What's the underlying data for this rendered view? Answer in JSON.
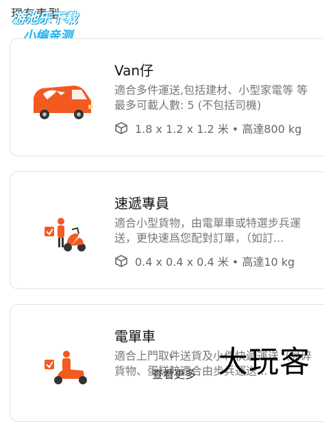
{
  "page": {
    "heading": "現有車型",
    "view_more": "查看更多"
  },
  "watermarks": {
    "top_left_line1": "游池乐下载",
    "top_left_line2": "小编亲测",
    "bottom_right": "大玩客"
  },
  "vehicles": [
    {
      "name": "Van仔",
      "description": "適合多件運送,包括建材、小型家電等 等 最多可載人數: 5 (不包括司機)",
      "spec": "1.8 x 1.2 x 1.2 米 • 高達800 kg",
      "icon": "van-icon"
    },
    {
      "name": "速遞專員",
      "description": "適合小型貨物，由電單車或特選步兵運送，更快速爲您配對訂單，（如訂...",
      "spec": "0.4 x 0.4 x 0.4 米 • 高達10 kg",
      "icon": "courier-scooter-icon"
    },
    {
      "name": "電單車",
      "description": "適合上門取件送貨及小件快遞運送（易碎貨物、蛋糕較適合由步兵運送...",
      "spec": "",
      "icon": "motorcycle-icon"
    }
  ],
  "colors": {
    "accent": "#f25a22"
  }
}
